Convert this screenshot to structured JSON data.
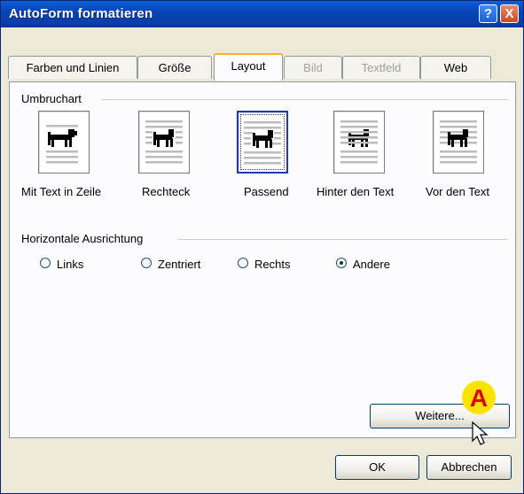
{
  "window": {
    "title": "AutoForm formatieren"
  },
  "titlebar_buttons": {
    "help": "?",
    "close": "X"
  },
  "tabs": [
    {
      "label": "Farben und Linien",
      "state": "normal"
    },
    {
      "label": "Größe",
      "state": "normal"
    },
    {
      "label": "Layout",
      "state": "active"
    },
    {
      "label": "Bild",
      "state": "disabled"
    },
    {
      "label": "Textfeld",
      "state": "disabled"
    },
    {
      "label": "Web",
      "state": "normal"
    }
  ],
  "wrap_section": {
    "title": "Umbruchart",
    "options": [
      {
        "label": "Mit Text in Zeile",
        "icon": "inline-wrap-icon",
        "selected": false
      },
      {
        "label": "Rechteck",
        "icon": "square-wrap-icon",
        "selected": false
      },
      {
        "label": "Passend",
        "icon": "tight-wrap-icon",
        "selected": true
      },
      {
        "label": "Hinter den Text",
        "icon": "behind-text-wrap-icon",
        "selected": false
      },
      {
        "label": "Vor den Text",
        "icon": "in-front-of-text-wrap-icon",
        "selected": false
      }
    ]
  },
  "alignment_section": {
    "title": "Horizontale Ausrichtung",
    "options": [
      {
        "label": "Links",
        "checked": false
      },
      {
        "label": "Zentriert",
        "checked": false
      },
      {
        "label": "Rechts",
        "checked": false
      },
      {
        "label": "Andere",
        "checked": true
      }
    ]
  },
  "buttons": {
    "more": "Weitere...",
    "ok": "OK",
    "cancel": "Abbrechen"
  },
  "annotation": {
    "marker": "A",
    "marker_color": "#ffe300",
    "marker_text_color": "#e0001a"
  },
  "colors": {
    "titlebar": "#0a44b8",
    "dialog": "#ece9d8",
    "tab_highlight": "#f7b031",
    "selection": "#1c3bb5"
  }
}
